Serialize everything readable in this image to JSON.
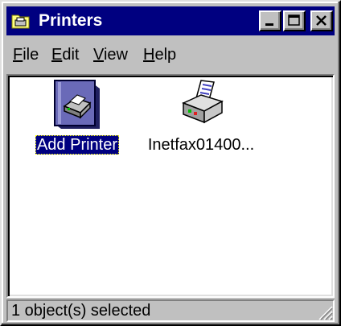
{
  "window": {
    "title": "Printers",
    "title_icon": "printers-folder-icon",
    "controls": [
      "minimize-icon",
      "maximize-icon",
      "close-icon"
    ],
    "colors": {
      "titlebar": "#000080",
      "face": "#c0c0c0",
      "selection": "#000080"
    }
  },
  "menu": {
    "file": {
      "accel": "F",
      "rest": "ile"
    },
    "edit": {
      "accel": "E",
      "rest": "dit"
    },
    "view": {
      "accel": "V",
      "rest": "iew"
    },
    "help": {
      "accel": "H",
      "rest": "elp"
    }
  },
  "items": [
    {
      "label": "Add Printer",
      "icon": "add-printer-icon",
      "selected": true
    },
    {
      "label": "Inetfax01400...",
      "icon": "printer-icon",
      "selected": false
    }
  ],
  "status": {
    "text": "1 object(s) selected"
  }
}
